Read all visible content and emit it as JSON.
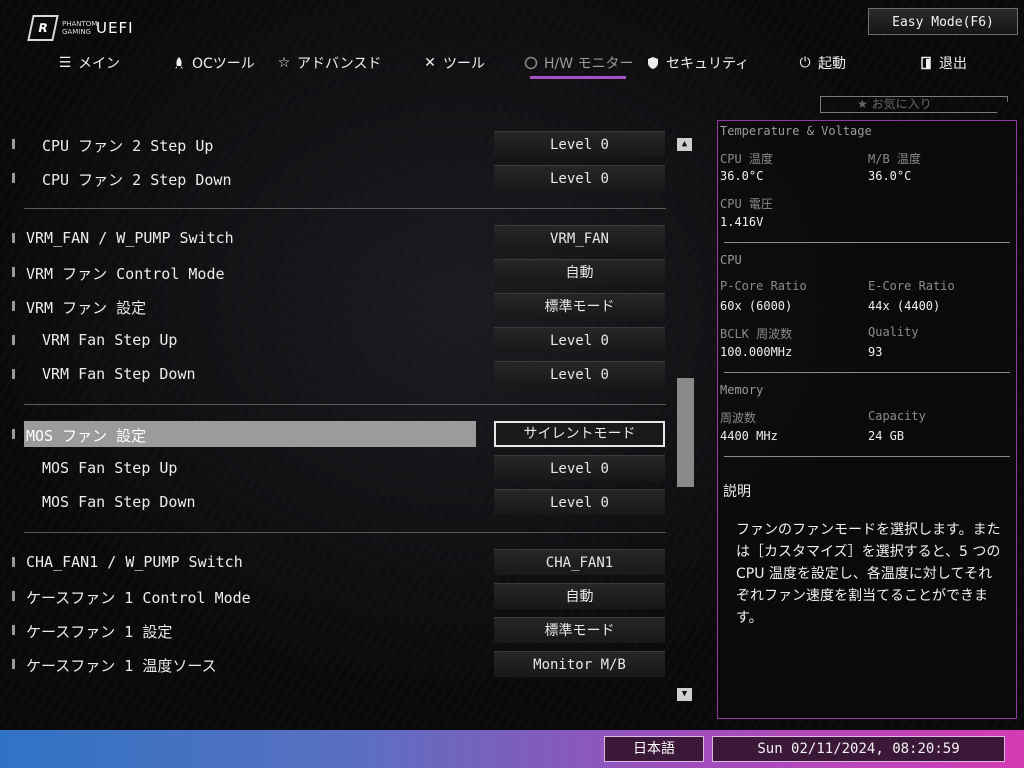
{
  "header": {
    "logo_small": "PHANTOM GAMING",
    "logo_big": "UEFI",
    "easy_mode_label": "Easy Mode(F6)"
  },
  "nav": [
    {
      "label": "メイン",
      "icon": "list-icon",
      "active": false
    },
    {
      "label": "OCツール",
      "icon": "rocket-icon",
      "active": false
    },
    {
      "label": "アドバンスド",
      "icon": "star-icon",
      "active": false
    },
    {
      "label": "ツール",
      "icon": "tools-icon",
      "active": false
    },
    {
      "label": "H/W モニター",
      "icon": "monitor-icon",
      "active": true
    },
    {
      "label": "セキュリティ",
      "icon": "shield-icon",
      "active": false
    },
    {
      "label": "起動",
      "icon": "power-icon",
      "active": false
    },
    {
      "label": "退出",
      "icon": "exit-icon",
      "active": false
    }
  ],
  "favorites_label": "お気に入り",
  "settings": [
    {
      "label": "CPU ファン 2 Step Up",
      "value": "Level 0"
    },
    {
      "label": "CPU ファン 2 Step Down",
      "value": "Level 0"
    },
    {
      "label": "VRM_FAN / W_PUMP Switch",
      "value": "VRM_FAN"
    },
    {
      "label": "VRM ファン Control Mode",
      "value": "自動"
    },
    {
      "label": "VRM ファン 設定",
      "value": "標準モード"
    },
    {
      "label": "VRM Fan Step Up",
      "value": "Level 0"
    },
    {
      "label": "VRM Fan Step Down",
      "value": "Level 0"
    },
    {
      "label": "MOS ファン 設定",
      "value": "サイレントモード"
    },
    {
      "label": "MOS Fan Step Up",
      "value": "Level 0"
    },
    {
      "label": "MOS Fan Step Down",
      "value": "Level 0"
    },
    {
      "label": "CHA_FAN1 / W_PUMP Switch",
      "value": "CHA_FAN1"
    },
    {
      "label": "ケースファン 1 Control Mode",
      "value": "自動"
    },
    {
      "label": "ケースファン 1 設定",
      "value": "標準モード"
    },
    {
      "label": "ケースファン 1 温度ソース",
      "value": "Monitor M/B"
    }
  ],
  "monitor": {
    "title": "Temperature & Voltage",
    "cpu_temp_label": "CPU 温度",
    "cpu_temp_value": "36.0°C",
    "mb_temp_label": "M/B 温度",
    "mb_temp_value": "36.0°C",
    "cpu_voltage_label": "CPU 電圧",
    "cpu_voltage_value": "1.416V",
    "cpu_section": "CPU",
    "pcore_label": "P-Core Ratio",
    "pcore_value": "60x (6000)",
    "ecore_label": "E-Core Ratio",
    "ecore_value": "44x (4400)",
    "bclk_label": "BCLK 周波数",
    "bclk_value": "100.000MHz",
    "quality_label": "Quality",
    "quality_value": "93",
    "memory_section": "Memory",
    "mem_freq_label": "周波数",
    "mem_freq_value": "4400 MHz",
    "capacity_label": "Capacity",
    "capacity_value": "24 GB",
    "desc_title": "説明",
    "desc_body": "ファンのファンモードを選択します。または［カスタマイズ］を選択すると、5 つの CPU 温度を設定し、各温度に対してそれぞれファン速度を割当てることができます。"
  },
  "footer": {
    "language": "日本語",
    "datetime": "Sun 02/11/2024, 08:20:59"
  },
  "colors": {
    "accent": "#a650c9",
    "panel_border": "#8d3b9f",
    "selected_row": "#9b9b9b"
  }
}
